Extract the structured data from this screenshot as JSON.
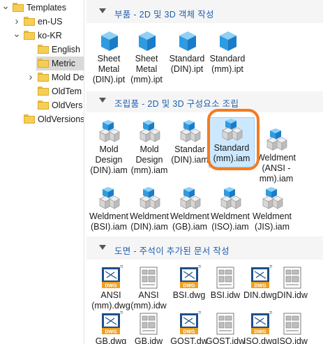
{
  "tree": {
    "items": [
      {
        "label": "Templates",
        "chevron": "down",
        "level": 0,
        "selected": false
      },
      {
        "label": "en-US",
        "chevron": "right",
        "level": 1,
        "selected": false
      },
      {
        "label": "ko-KR",
        "chevron": "down",
        "level": 1,
        "selected": false
      },
      {
        "label": "English",
        "chevron": "",
        "level": 2,
        "selected": false
      },
      {
        "label": "Metric",
        "chevron": "",
        "level": 2,
        "selected": true
      },
      {
        "label": "Mold De",
        "chevron": "right",
        "level": 2,
        "selected": false
      },
      {
        "label": "OldTem",
        "chevron": "",
        "level": 2,
        "selected": false
      },
      {
        "label": "OldVers",
        "chevron": "",
        "level": 2,
        "selected": false
      },
      {
        "label": "OldVersions",
        "chevron": "",
        "level": 1,
        "selected": false
      }
    ]
  },
  "sections": [
    {
      "title": "부품 - 2D 및 3D 객체 작성",
      "items": [
        {
          "label": "Sheet\nMetal\n(DIN).ipt",
          "icon": "part-cube-icon"
        },
        {
          "label": "Sheet\nMetal\n(mm).ipt",
          "icon": "part-cube-icon"
        },
        {
          "label": "Standard\n(DIN).ipt",
          "icon": "part-cube-icon"
        },
        {
          "label": "Standard\n(mm).ipt",
          "icon": "part-cube-icon"
        }
      ]
    },
    {
      "title": "조립품 - 2D 및 3D 구성요소 조립",
      "items": [
        {
          "label": "Mold\nDesign\n(DIN).iam",
          "icon": "assembly-icon"
        },
        {
          "label": "Mold\nDesign\n(mm).iam",
          "icon": "assembly-icon"
        },
        {
          "label": "Standar\n(DIN).iam",
          "icon": "assembly-icon"
        },
        {
          "label": "Standard\n(mm).iam",
          "icon": "assembly-icon",
          "highlight": true
        },
        {
          "label": "Weldment\n(ANSI -\nmm).iam",
          "icon": "assembly-icon"
        },
        {
          "label": "Weldment\n(BSI).iam",
          "icon": "assembly-icon"
        },
        {
          "label": "Weldment\n(DIN).iam",
          "icon": "assembly-icon"
        },
        {
          "label": "Weldment\n(GB).iam",
          "icon": "assembly-icon"
        },
        {
          "label": "Weldment\n(ISO).iam",
          "icon": "assembly-icon"
        },
        {
          "label": "Weldment\n(JIS).iam",
          "icon": "assembly-icon"
        }
      ]
    },
    {
      "title": "도면 - 주석이 추가된 문서 작성",
      "items": [
        {
          "label": "ANSI\n(mm).dwg",
          "icon": "dwg-icon"
        },
        {
          "label": "ANSI\n(mm).idw",
          "icon": "idw-icon"
        },
        {
          "label": "BSI.dwg",
          "icon": "dwg-icon"
        },
        {
          "label": "BSI.idw",
          "icon": "idw-icon"
        },
        {
          "label": "DIN.dwg",
          "icon": "dwg-icon"
        },
        {
          "label": "DIN.idw",
          "icon": "idw-icon"
        },
        {
          "label": "GB.dwg",
          "icon": "dwg-icon"
        },
        {
          "label": "GB.idw",
          "icon": "idw-icon"
        },
        {
          "label": "GOST.dwg",
          "icon": "dwg-icon"
        },
        {
          "label": "GOST.idw",
          "icon": "idw-icon"
        },
        {
          "label": "ISO.dwg",
          "icon": "dwg-icon"
        },
        {
          "label": "ISO.idw",
          "icon": "idw-icon"
        }
      ]
    }
  ],
  "icon_text": {
    "dwg": "DWG",
    "tm": "TM"
  },
  "colors": {
    "accent": "#f47b20",
    "section_title": "#1f5fb0",
    "selected_row": "#d9d9d9",
    "highlight": "#cce8ff"
  }
}
